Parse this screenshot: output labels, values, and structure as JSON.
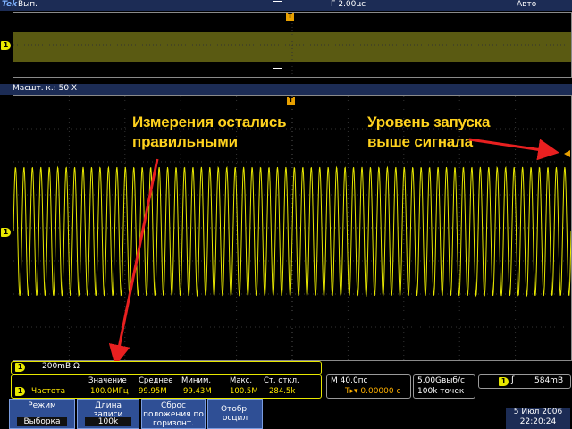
{
  "top_bar": {
    "logo": "Tek",
    "acq_state": "Вып.",
    "timebase": "Г 2.00µс",
    "trigger_mode": "Авто"
  },
  "zoom_bar": {
    "label": "Масшт. к.: 50 X"
  },
  "channel": {
    "marker": "1",
    "trigger_marker": "T"
  },
  "annotations": {
    "left_line1": "Измерения остались",
    "left_line2": "правильными",
    "right_line1": "Уровень запуска",
    "right_line2": "выше сигнала"
  },
  "channel_scale": {
    "badge": "1",
    "value": "200mВ Ω"
  },
  "measurements": {
    "badge": "1",
    "name": "Частота",
    "headers": [
      "Значение",
      "Среднее",
      "Миним.",
      "Макс.",
      "Ст. откл."
    ],
    "values": [
      "100.0MГц",
      "99.95M",
      "99.43M",
      "100.5M",
      "284.5k"
    ]
  },
  "horizontal": {
    "line1": "M 40.0пс",
    "line2": "T▸▾ 0.00000 с"
  },
  "sampling": {
    "line1": "5.00Gвыб/с",
    "line2": "100k точек"
  },
  "trigger": {
    "badge": "1",
    "slope": "ʃ",
    "level": "584mВ"
  },
  "menu": [
    {
      "label": "Режим",
      "value": "Выборка"
    },
    {
      "label": "Длина записи",
      "value": "100k"
    },
    {
      "label": "Сброс положения по горизонт.",
      "value": ""
    },
    {
      "label": "Отобр. осцил",
      "value": ""
    }
  ],
  "datetime": {
    "date": "5 Июл 2006",
    "time": "22:20:24"
  },
  "colors": {
    "trace": "#e8e800",
    "annotation": "#ffd21e",
    "arrow": "#e82020",
    "menu": "#2f4f95",
    "header": "#1c2c55"
  },
  "waveform": {
    "channel": 1,
    "cycles_visible": 66
  }
}
